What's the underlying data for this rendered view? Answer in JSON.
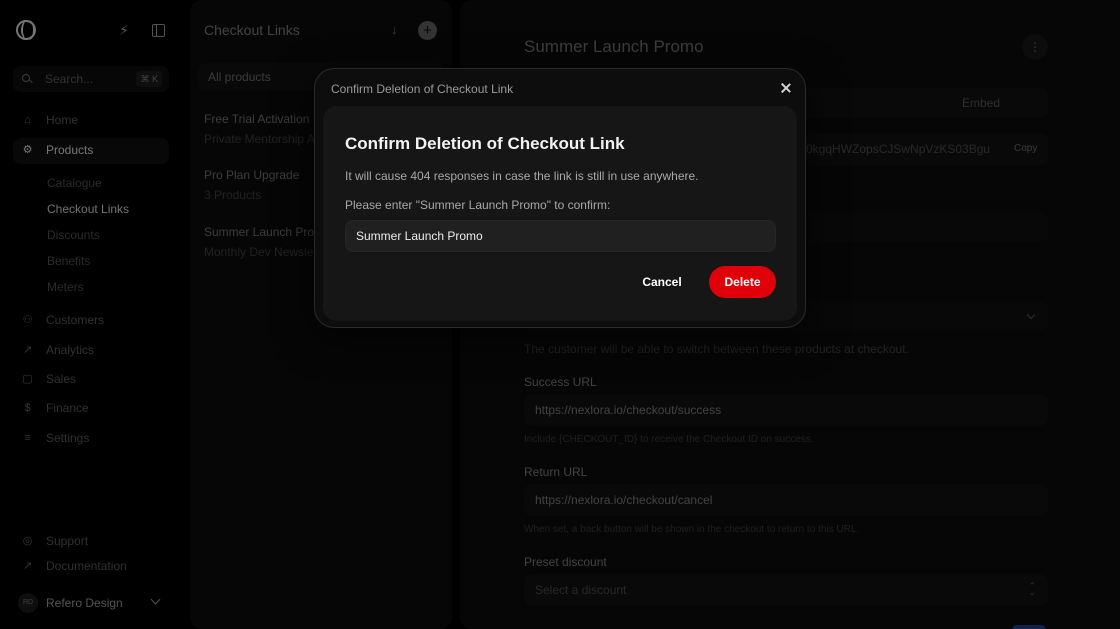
{
  "sidebar": {
    "search_placeholder": "Search...",
    "search_shortcut": "⌘ K",
    "nav": [
      {
        "label": "Home",
        "icon": "home-icon"
      },
      {
        "label": "Products",
        "icon": "products-icon"
      },
      {
        "label": "Customers",
        "icon": "customers-icon"
      },
      {
        "label": "Analytics",
        "icon": "analytics-icon"
      },
      {
        "label": "Sales",
        "icon": "sales-icon"
      },
      {
        "label": "Finance",
        "icon": "finance-icon"
      },
      {
        "label": "Settings",
        "icon": "settings-icon"
      }
    ],
    "product_sub": [
      "Catalogue",
      "Checkout Links",
      "Discounts",
      "Benefits",
      "Meters"
    ],
    "footer": [
      {
        "label": "Support",
        "icon": "support-icon"
      },
      {
        "label": "Documentation",
        "icon": "documentation-icon"
      }
    ],
    "org": {
      "initials": "RD",
      "name": "Refero Design"
    }
  },
  "list": {
    "title": "Checkout Links",
    "filter": "All products",
    "items": [
      {
        "title": "Free Trial Activation",
        "subtitle": "Private Mentorship A"
      },
      {
        "title": "Pro Plan Upgrade",
        "subtitle": "3 Products"
      },
      {
        "title": "Summer Launch Pro",
        "subtitle": "Monthly Dev Newsle"
      }
    ]
  },
  "detail": {
    "title": "Summer Launch Promo",
    "tab_embed": "Embed",
    "link_value": "0kgqHWZopsCJSwNpVzKS03Bgu",
    "copy_label": "Copy",
    "products_helper": "The customer will be able to switch between these products at checkout.",
    "success_url": {
      "label": "Success URL",
      "value": "https://nexlora.io/checkout/success",
      "helper": "Include {CHECKOUT_ID} to receive the Checkout ID on success."
    },
    "return_url": {
      "label": "Return URL",
      "value": "https://nexlora.io/checkout/cancel",
      "helper": "When set, a back button will be shown in the checkout to return to this URL."
    },
    "preset_discount": {
      "label": "Preset discount",
      "placeholder": "Select a discount"
    }
  },
  "modal": {
    "header_title": "Confirm Deletion of Checkout Link",
    "title": "Confirm Deletion of Checkout Link",
    "description": "It will cause 404 responses in case the link is still in use anywhere.",
    "prompt": "Please enter \"Summer Launch Promo\" to confirm:",
    "input_value": "Summer Launch Promo",
    "cancel_label": "Cancel",
    "delete_label": "Delete",
    "delete_color": "#e0000a"
  }
}
